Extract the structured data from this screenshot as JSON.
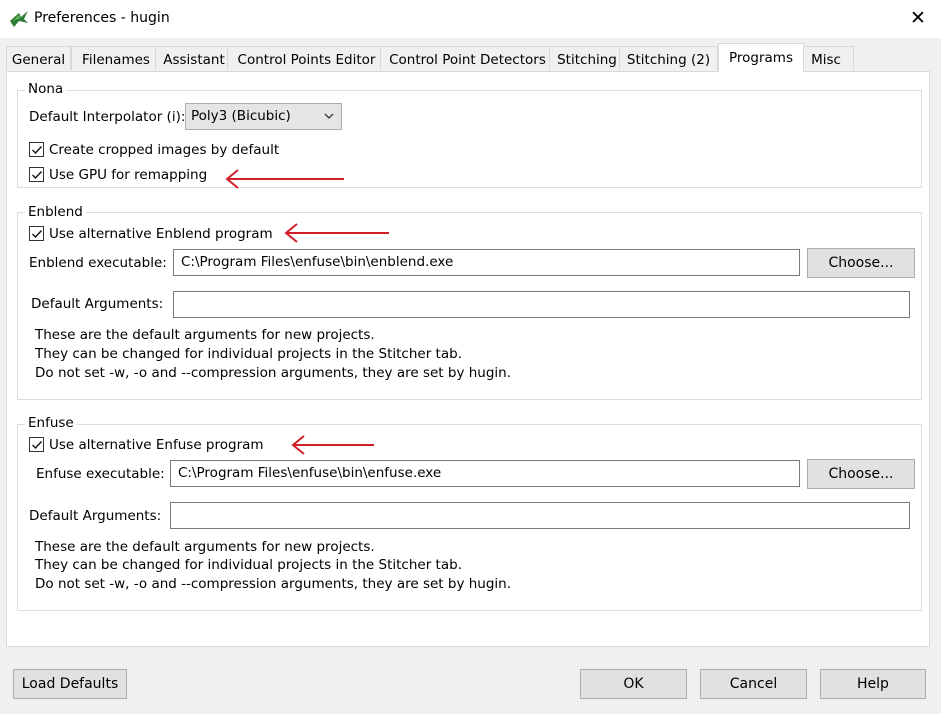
{
  "window": {
    "title": "Preferences - hugin",
    "close_glyph": "✕"
  },
  "tabs": [
    {
      "label": "General"
    },
    {
      "label": "Filenames"
    },
    {
      "label": "Assistant"
    },
    {
      "label": "Control Points Editor"
    },
    {
      "label": "Control Point Detectors"
    },
    {
      "label": "Stitching"
    },
    {
      "label": "Stitching (2)"
    },
    {
      "label": "Programs",
      "active": true
    },
    {
      "label": "Misc"
    }
  ],
  "nona": {
    "legend": "Nona",
    "interpolator_label": "Default Interpolator (i):",
    "interpolator_value": "Poly3 (Bicubic)",
    "cropped_label": "Create cropped images by default",
    "cropped_checked": true,
    "gpu_label": "Use GPU for remapping",
    "gpu_checked": true
  },
  "enblend": {
    "legend": "Enblend",
    "use_alt_label": "Use alternative Enblend program",
    "use_alt_checked": true,
    "exe_label": "Enblend executable:",
    "exe_value": "C:\\Program Files\\enfuse\\bin\\enblend.exe",
    "choose_label": "Choose...",
    "args_label": "Default Arguments:",
    "args_value": "",
    "help_lines": [
      "These are the default arguments for new projects.",
      "They can be changed for individual projects in the Stitcher tab.",
      "Do not set -w, -o and --compression arguments, they are set by hugin."
    ]
  },
  "enfuse": {
    "legend": "Enfuse",
    "use_alt_label": "Use alternative Enfuse program",
    "use_alt_checked": true,
    "exe_label": "Enfuse executable:",
    "exe_value": "C:\\Program Files\\enfuse\\bin\\enfuse.exe",
    "choose_label": "Choose...",
    "args_label": "Default Arguments:",
    "args_value": "",
    "help_lines": [
      "These are the default arguments for new projects.",
      "They can be changed for individual projects in the Stitcher tab.",
      "Do not set -w, -o and --compression arguments, they are set by hugin."
    ]
  },
  "buttons": {
    "load_defaults": "Load Defaults",
    "ok": "OK",
    "cancel": "Cancel",
    "help": "Help"
  },
  "annotations": {
    "arrow_color": "#d0202a"
  }
}
